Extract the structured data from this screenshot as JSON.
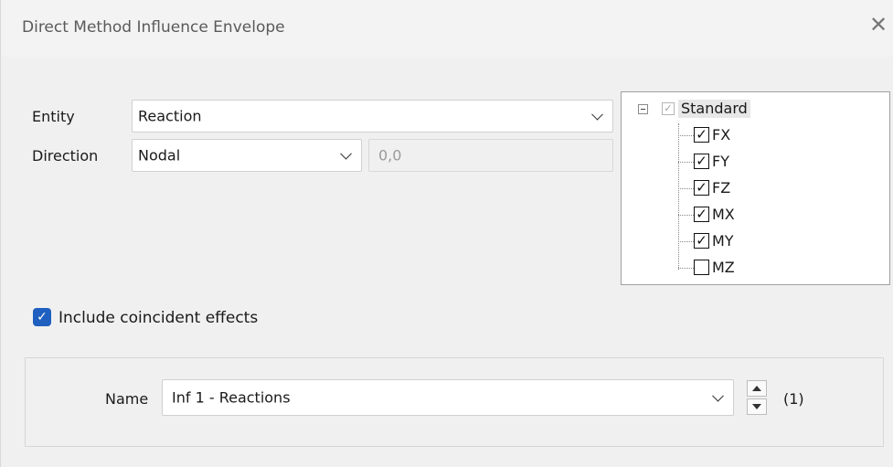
{
  "window": {
    "title": "Direct Method Influence Envelope",
    "close_glyph": "✕"
  },
  "form": {
    "entity_label": "Entity",
    "entity_value": "Reaction",
    "direction_label": "Direction",
    "direction_value": "Nodal",
    "direction_extra": "0,0"
  },
  "tree": {
    "root_label": "Standard",
    "root_check_glyph": "✓",
    "items": [
      {
        "label": "FX",
        "checked": true,
        "glyph": "✓"
      },
      {
        "label": "FY",
        "checked": true,
        "glyph": "✓"
      },
      {
        "label": "FZ",
        "checked": true,
        "glyph": "✓"
      },
      {
        "label": "MX",
        "checked": true,
        "glyph": "✓"
      },
      {
        "label": "MY",
        "checked": true,
        "glyph": "✓"
      },
      {
        "label": "MZ",
        "checked": false,
        "glyph": ""
      }
    ]
  },
  "include_coincident": {
    "label": "Include coincident effects",
    "checked": true,
    "glyph": "✓"
  },
  "name_group": {
    "label": "Name",
    "value": "Inf 1 - Reactions",
    "count": "(1)"
  },
  "colors": {
    "accent": "#1f5fbf",
    "tree_border": "#a0a0a0",
    "dialog_bg": "#f0f0f0"
  }
}
